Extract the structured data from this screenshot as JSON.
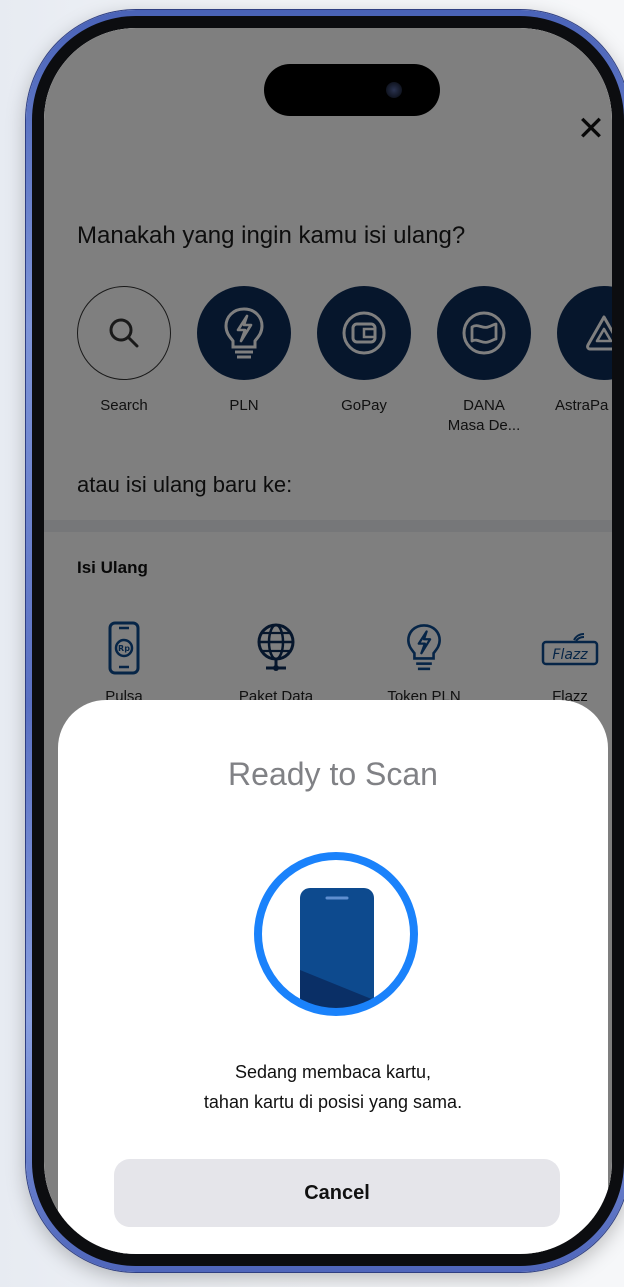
{
  "app": {
    "close_label": "✕",
    "question": "Manakah yang ingin kamu isi ulang?",
    "shortcuts": [
      {
        "label": "Search",
        "icon": "search-icon"
      },
      {
        "label": "PLN",
        "icon": "lightbulb-bolt-icon"
      },
      {
        "label": "GoPay",
        "icon": "wallet-icon"
      },
      {
        "label": "DANA\nMasa De...",
        "icon": "dana-icon"
      },
      {
        "label": "AstraPa",
        "icon": "astrapay-icon"
      }
    ],
    "subheading": "atau isi ulang baru ke:",
    "section_title": "Isi Ulang",
    "products": [
      {
        "label": "Pulsa",
        "icon": "phone-rp-icon"
      },
      {
        "label": "Paket Data",
        "icon": "globe-icon"
      },
      {
        "label": "Token PLN",
        "icon": "lightbulb-bolt-icon"
      },
      {
        "label": "Flazz",
        "icon": "flazz-card-icon"
      }
    ]
  },
  "sheet": {
    "title": "Ready to Scan",
    "message_line1": "Sedang membaca kartu,",
    "message_line2": "tahan kartu di posisi yang sama.",
    "cancel_label": "Cancel"
  },
  "colors": {
    "dark_navy": "#0d2c58",
    "scan_blue": "#1a82fb",
    "phone_blue": "#0d4a8e",
    "frame_blue": "#5a70c2"
  }
}
